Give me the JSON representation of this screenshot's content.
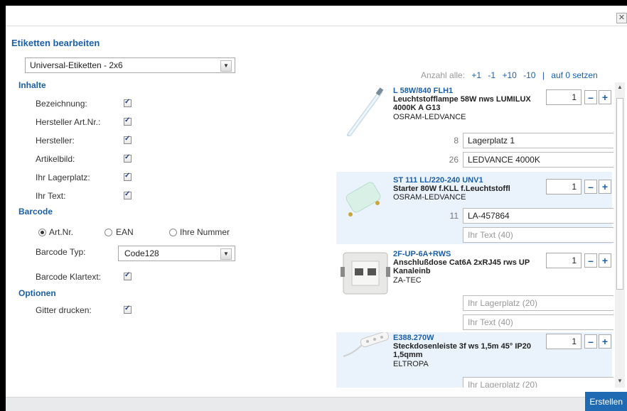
{
  "dialog": {
    "title": "Etiketten bearbeiten",
    "close": "✕",
    "create_button": "Erstellen",
    "label_format": "Universal-Etiketten - 2x6"
  },
  "sections": {
    "contents": "Inhalte",
    "barcode": "Barcode",
    "options": "Optionen"
  },
  "contents_options": [
    {
      "label": "Bezeichnung:",
      "checked": true
    },
    {
      "label": "Hersteller Art.Nr.:",
      "checked": true
    },
    {
      "label": "Hersteller:",
      "checked": true
    },
    {
      "label": "Artikelbild:",
      "checked": true
    },
    {
      "label": "Ihr Lagerplatz:",
      "checked": true
    },
    {
      "label": "Ihr Text:",
      "checked": true
    }
  ],
  "barcode": {
    "radio_artnr": "Art.Nr.",
    "radio_ean": "EAN",
    "radio_own": "Ihre Nummer",
    "selected": "Art.Nr.",
    "type_label": "Barcode Typ:",
    "type_value": "Code128",
    "plaintext_label": "Barcode Klartext:",
    "plaintext_checked": true
  },
  "options": {
    "grid_label": "Gitter drucken:",
    "grid_checked": true
  },
  "count_bar": {
    "label": "Anzahl alle:",
    "plus1": "+1",
    "minus1": "-1",
    "plus10": "+10",
    "minus10": "-10",
    "sep": "|",
    "reset": "auf 0 setzen"
  },
  "items": [
    {
      "code": "L 58W/840 FLH1",
      "name": "Leuchtstofflampe 58W nws LUMILUX 4000K A G13",
      "maker": "OSRAM-LEDVANCE",
      "qty": "1",
      "storage_len": "8",
      "storage": "Lagerplatz 1",
      "text_len": "26",
      "text": "LEDVANCE 4000K"
    },
    {
      "code": "ST 111 LL/220-240 UNV1",
      "name": "Starter 80W f.KLL f.Leuchtstoffl",
      "maker": "OSRAM-LEDVANCE",
      "qty": "1",
      "storage_len": "11",
      "storage": "LA-457864",
      "text_placeholder": "Ihr Text (40)"
    },
    {
      "code": "2F-UP-6A+RWS",
      "name": "Anschlußdose Cat6A 2xRJ45 rws UP Kanaleinb",
      "maker": "ZA-TEC",
      "qty": "1",
      "storage_placeholder": "Ihr Lagerplatz (20)",
      "text_placeholder": "Ihr Text (40)"
    },
    {
      "code": "E388.270W",
      "name": "Steckdosenleiste 3f ws 1,5m 45° IP20 1,5qmm",
      "maker": "ELTROPA",
      "qty": "1",
      "storage_placeholder": "Ihr Lagerplatz (20)"
    }
  ],
  "qty_minus": "–",
  "qty_plus": "+"
}
